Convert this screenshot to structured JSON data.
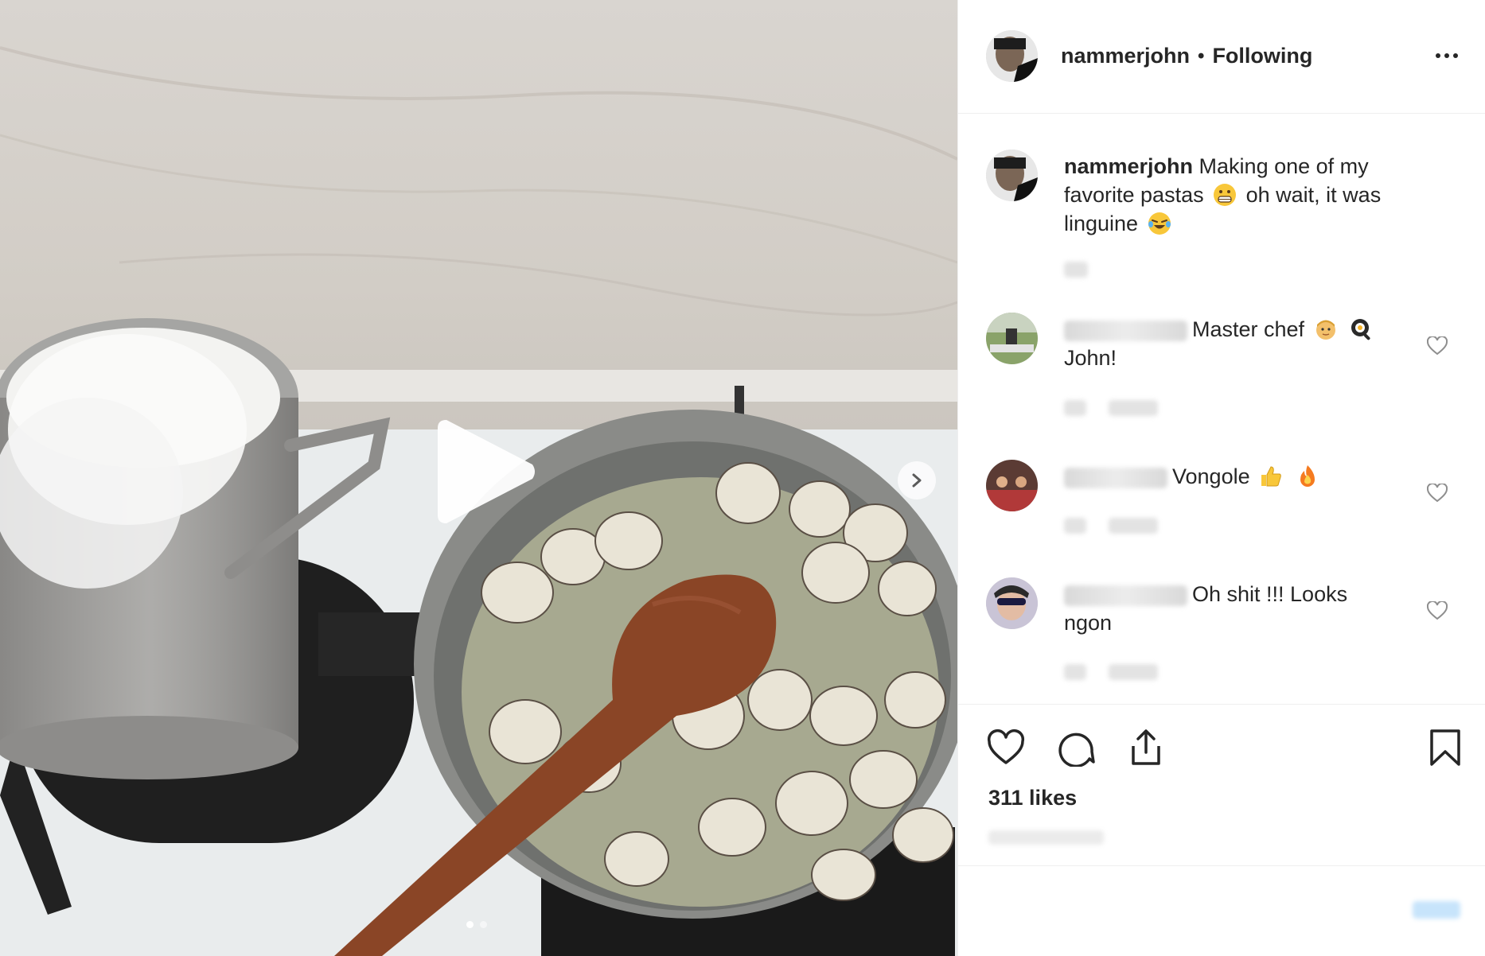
{
  "post": {
    "carousel": {
      "slide_count": 2,
      "active_index": 0
    }
  },
  "header": {
    "username": "nammerjohn",
    "separator": "•",
    "follow_status": "Following"
  },
  "caption": {
    "username": "nammerjohn",
    "text_part1": "Making one of my favorite pastas",
    "text_part2": "oh wait, it was linguine"
  },
  "comments": [
    {
      "text": "Master chef",
      "text_after": "John!"
    },
    {
      "text": "Vongole"
    },
    {
      "text": "Oh shit !!! Looks ngon"
    }
  ],
  "stats": {
    "likes": "311 likes"
  },
  "colors": {
    "accent": "#3897f0",
    "text": "#262626",
    "border": "#efefef"
  }
}
